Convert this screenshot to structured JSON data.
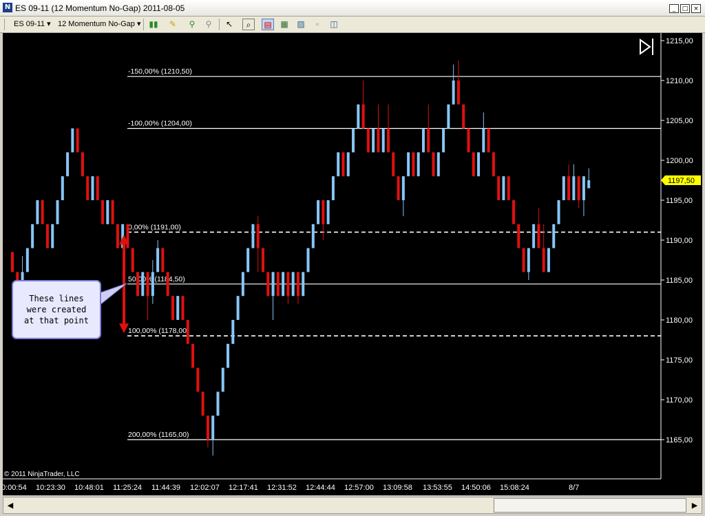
{
  "window": {
    "title": "ES 09-11 (12 Momentum No-Gap)  2011-08-05",
    "app_icon": "ninjatrader-icon",
    "buttons": [
      "minimize",
      "maximize",
      "close"
    ]
  },
  "toolbar": {
    "instrument": "ES 09-11",
    "interval": "12 Momentum No-Gap"
  },
  "chart": {
    "copyright": "© 2011 NinjaTrader, LLC",
    "current_price_label": "1197,50",
    "annotation": "These lines\nwere created\nat that point",
    "annotation_lines": [
      "These lines",
      "were created",
      "at that point"
    ],
    "colors": {
      "up": "#87c6f7",
      "down": "#e01010",
      "background": "#000000",
      "price_tag": "#ffff00"
    }
  },
  "chart_data": {
    "type": "candlestick",
    "y_ticks": [
      "1215,00",
      "1210,00",
      "1205,00",
      "1200,00",
      "1195,00",
      "1190,00",
      "1185,00",
      "1180,00",
      "1175,00",
      "1170,00",
      "1165,00"
    ],
    "ylim": [
      1162,
      1216
    ],
    "x_ticks": [
      "0:00:54",
      "10:23:30",
      "10:48:01",
      "11:25:24",
      "11:44:39",
      "12:02:07",
      "12:17:41",
      "12:31:52",
      "12:44:44",
      "12:57:00",
      "13:09:58",
      "13:53:55",
      "14:50:06",
      "15:08:24",
      "8/7"
    ],
    "fib_levels": [
      {
        "label": "-150,00% (1210,50)",
        "price": 1210.5,
        "style": "solid"
      },
      {
        "label": "-100,00% (1204,00)",
        "price": 1204.0,
        "style": "solid"
      },
      {
        "label": "0,00% (1191,00)",
        "price": 1191.0,
        "style": "dashed"
      },
      {
        "label": "50,00% (1184,50)",
        "price": 1184.5,
        "style": "solid"
      },
      {
        "label": "100,00% (1178,00)",
        "price": 1178.0,
        "style": "dashed"
      },
      {
        "label": "200,00% (1165,00)",
        "price": 1165.0,
        "style": "solid"
      }
    ],
    "bars": [
      [
        1188.5,
        1186,
        1186,
        1188.5
      ],
      [
        1186,
        1183,
        1183,
        1186
      ],
      [
        1183,
        1186,
        1183,
        1188
      ],
      [
        1186,
        1189,
        1186,
        1189
      ],
      [
        1189,
        1192,
        1189,
        1192
      ],
      [
        1192,
        1195,
        1192,
        1195
      ],
      [
        1195,
        1192,
        1192,
        1195
      ],
      [
        1192,
        1189,
        1189,
        1192
      ],
      [
        1189,
        1192,
        1189,
        1192
      ],
      [
        1192,
        1195,
        1192,
        1195
      ],
      [
        1195,
        1198,
        1195,
        1198
      ],
      [
        1198,
        1201,
        1198,
        1201
      ],
      [
        1201,
        1204,
        1201,
        1204
      ],
      [
        1204,
        1201,
        1201,
        1204
      ],
      [
        1201,
        1198,
        1198,
        1201
      ],
      [
        1198,
        1195,
        1195,
        1198
      ],
      [
        1195,
        1198,
        1195,
        1198
      ],
      [
        1198,
        1195,
        1195,
        1198
      ],
      [
        1195,
        1192,
        1192,
        1195
      ],
      [
        1192,
        1195,
        1192,
        1195
      ],
      [
        1195,
        1192,
        1192,
        1195
      ],
      [
        1192,
        1189,
        1189,
        1192
      ],
      [
        1189,
        1192,
        1189,
        1192
      ],
      [
        1192,
        1189,
        1189,
        1192
      ],
      [
        1189,
        1186,
        1186,
        1189
      ],
      [
        1186,
        1183,
        1183,
        1186
      ],
      [
        1183,
        1186,
        1183,
        1186
      ],
      [
        1186,
        1183,
        1180,
        1186
      ],
      [
        1183,
        1186,
        1182,
        1187.5
      ],
      [
        1186,
        1189,
        1186,
        1190
      ],
      [
        1189,
        1186,
        1186,
        1189
      ],
      [
        1186,
        1183,
        1183,
        1186
      ],
      [
        1183,
        1180,
        1180,
        1183
      ],
      [
        1180,
        1183,
        1180,
        1183
      ],
      [
        1183,
        1180,
        1180,
        1183
      ],
      [
        1180,
        1177,
        1177,
        1180
      ],
      [
        1177,
        1174,
        1174,
        1177
      ],
      [
        1174,
        1171,
        1171,
        1174
      ],
      [
        1171,
        1168,
        1168,
        1171
      ],
      [
        1168,
        1165,
        1164,
        1168
      ],
      [
        1165,
        1168,
        1163,
        1168
      ],
      [
        1168,
        1171,
        1168,
        1171
      ],
      [
        1171,
        1174,
        1171,
        1174
      ],
      [
        1174,
        1177,
        1174,
        1177
      ],
      [
        1177,
        1180,
        1177,
        1180
      ],
      [
        1180,
        1183,
        1180,
        1183
      ],
      [
        1183,
        1186,
        1183,
        1186
      ],
      [
        1186,
        1189,
        1186,
        1189
      ],
      [
        1189,
        1192,
        1189,
        1192
      ],
      [
        1192,
        1189,
        1186,
        1193
      ],
      [
        1189,
        1186,
        1186,
        1189
      ],
      [
        1186,
        1183,
        1183,
        1186
      ],
      [
        1183,
        1186,
        1180,
        1186
      ],
      [
        1186,
        1183,
        1183,
        1186
      ],
      [
        1183,
        1186,
        1183,
        1186
      ],
      [
        1186,
        1183,
        1182,
        1186
      ],
      [
        1183,
        1186,
        1183,
        1186
      ],
      [
        1186,
        1183,
        1182,
        1186
      ],
      [
        1183,
        1186,
        1183,
        1186
      ],
      [
        1186,
        1189,
        1186,
        1189
      ],
      [
        1189,
        1192,
        1189,
        1192
      ],
      [
        1192,
        1195,
        1192,
        1195
      ],
      [
        1195,
        1192,
        1190,
        1195
      ],
      [
        1192,
        1195,
        1192,
        1195
      ],
      [
        1195,
        1198,
        1195,
        1198
      ],
      [
        1198,
        1201,
        1198,
        1201
      ],
      [
        1201,
        1198,
        1198,
        1201
      ],
      [
        1198,
        1201,
        1198,
        1201
      ],
      [
        1201,
        1204,
        1201,
        1204
      ],
      [
        1204,
        1207,
        1204,
        1207
      ],
      [
        1207,
        1204,
        1204,
        1210
      ],
      [
        1204,
        1201,
        1201,
        1204
      ],
      [
        1201,
        1204,
        1201,
        1204
      ],
      [
        1204,
        1201,
        1201,
        1207
      ],
      [
        1201,
        1204,
        1201,
        1204
      ],
      [
        1204,
        1201,
        1201,
        1207
      ],
      [
        1201,
        1198,
        1198,
        1201
      ],
      [
        1198,
        1195,
        1195,
        1198
      ],
      [
        1195,
        1198,
        1193,
        1198
      ],
      [
        1198,
        1201,
        1198,
        1201
      ],
      [
        1201,
        1198,
        1198,
        1201
      ],
      [
        1198,
        1201,
        1198,
        1201
      ],
      [
        1201,
        1204,
        1201,
        1204
      ],
      [
        1204,
        1201,
        1201,
        1207
      ],
      [
        1201,
        1198,
        1198,
        1201
      ],
      [
        1198,
        1201,
        1198,
        1201
      ],
      [
        1201,
        1204,
        1201,
        1204
      ],
      [
        1204,
        1207,
        1204,
        1207
      ],
      [
        1207,
        1210,
        1207,
        1212
      ],
      [
        1210,
        1207,
        1207,
        1212.5
      ],
      [
        1207,
        1204,
        1204,
        1207
      ],
      [
        1204,
        1201,
        1201,
        1204
      ],
      [
        1201,
        1198,
        1198,
        1201
      ],
      [
        1198,
        1201,
        1198,
        1201
      ],
      [
        1201,
        1204,
        1201,
        1206
      ],
      [
        1204,
        1201,
        1201,
        1204
      ],
      [
        1201,
        1198,
        1198,
        1201
      ],
      [
        1198,
        1195,
        1195,
        1198
      ],
      [
        1195,
        1198,
        1195,
        1198
      ],
      [
        1198,
        1195,
        1195,
        1198
      ],
      [
        1195,
        1192,
        1192,
        1195
      ],
      [
        1192,
        1189,
        1189,
        1192
      ],
      [
        1189,
        1186,
        1186,
        1189
      ],
      [
        1186,
        1189,
        1185,
        1189
      ],
      [
        1189,
        1192,
        1189,
        1192
      ],
      [
        1192,
        1189,
        1189,
        1194
      ],
      [
        1189,
        1186,
        1186,
        1192
      ],
      [
        1186,
        1189,
        1186,
        1189
      ],
      [
        1189,
        1192,
        1189,
        1192
      ],
      [
        1192,
        1195,
        1192,
        1195
      ],
      [
        1195,
        1198,
        1195,
        1198
      ],
      [
        1198,
        1195,
        1195,
        1199.5
      ],
      [
        1195,
        1198,
        1195,
        1199.5
      ],
      [
        1198,
        1195,
        1194,
        1198
      ],
      [
        1195,
        1198,
        1193,
        1198
      ],
      [
        1196.5,
        1197.5,
        1196.5,
        1199
      ]
    ]
  }
}
